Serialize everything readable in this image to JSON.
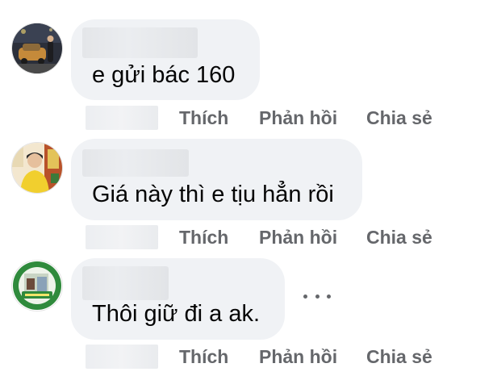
{
  "comments": [
    {
      "text": "e gửi bác 160",
      "avatar_icon": "car-photo-avatar-icon",
      "actions": {
        "like": "Thích",
        "reply": "Phản hồi",
        "share": "Chia sẻ"
      }
    },
    {
      "text": "Giá này thì e tịu hẳn rồi",
      "avatar_icon": "person-photo-avatar-icon",
      "actions": {
        "like": "Thích",
        "reply": "Phản hồi",
        "share": "Chia sẻ"
      }
    },
    {
      "text": "Thôi giữ đi a ak.",
      "avatar_icon": "shop-logo-avatar-icon",
      "actions": {
        "like": "Thích",
        "reply": "Phản hồi",
        "share": "Chia sẻ"
      },
      "more_icon": "more-options-icon"
    }
  ],
  "colors": {
    "bubble": "#f0f2f5",
    "text": "#050505",
    "action_text": "#65676b",
    "redacted": "#e4e6e9"
  }
}
